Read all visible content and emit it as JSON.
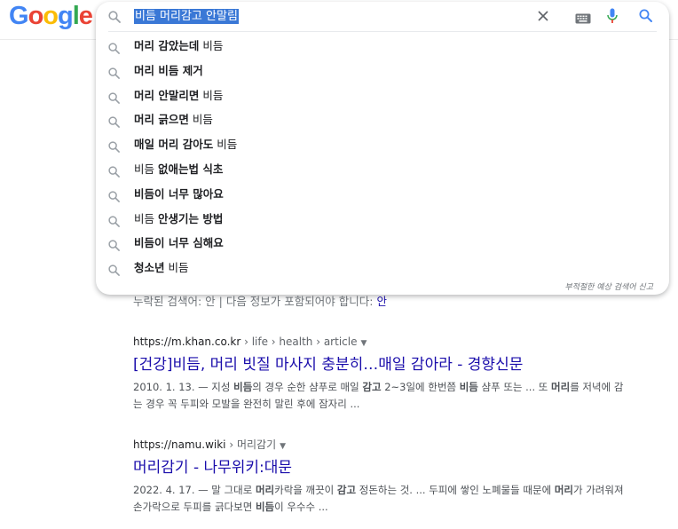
{
  "brand": {
    "logo_letters": [
      "G",
      "o",
      "o",
      "g",
      "l",
      "e"
    ],
    "logo_colors": [
      "#4285f4",
      "#ea4335",
      "#fbbc05",
      "#4285f4",
      "#34a853",
      "#ea4335"
    ]
  },
  "search": {
    "query": "비듬 머리감고 안말림",
    "icons": {
      "lens": "search-icon",
      "clear": "close-icon",
      "keyboard": "keyboard-icon",
      "mic": "mic-icon",
      "submit": "search-icon"
    }
  },
  "suggestions": [
    {
      "bold": "머리 감았는데",
      "rest": " 비듬"
    },
    {
      "bold": "머리 비듬 제거",
      "rest": ""
    },
    {
      "bold": "머리 안말리면",
      "rest": " 비듬"
    },
    {
      "bold": "머리 긁으면",
      "rest": " 비듬"
    },
    {
      "bold": "매일 머리 감아도",
      "rest": " 비듬"
    },
    {
      "bold_pre": "",
      "pre": "비듬 ",
      "bold": "없애는법 식초",
      "rest": ""
    },
    {
      "bold": "비듬이 너무 많아요",
      "rest": ""
    },
    {
      "pre": "비듬 ",
      "bold": "안생기는 방법",
      "rest": ""
    },
    {
      "bold": "비듬이 너무 심해요",
      "rest": ""
    },
    {
      "bold": "청소년",
      "rest": " 비듬"
    }
  ],
  "report_link": "부적절한 예상 검색어 신고",
  "partial_line": {
    "text": "누락된 검색어: 안 | 다음 정보가 포함되어야 합니다:",
    "link": "안"
  },
  "results": [
    {
      "site": "https://m.khan.co.kr",
      "crumbs": " › life › health › article",
      "title": "[건강]비듬, 머리 빗질 마사지 충분히…매일 감아라 - 경향신문",
      "snippet_html": "2010. 1. 13. — 지성 <b>비듬</b>의 경우 순한 샴푸로 매일 <b>감고</b> 2~3일에 한번쯤 <b>비듬</b> 샴푸 또는 ... 또 <b>머리</b>를 저녁에 감는 경우 꼭 두피와 모발을 완전히 말린 후에 잠자리 ..."
    },
    {
      "site": "https://namu.wiki",
      "crumbs": " › 머리감기",
      "title": "머리감기 - 나무위키:대문",
      "snippet_html": "2022. 4. 17. — 말 그대로 <b>머리</b>카락을 깨끗이 <b>감고</b> 정돈하는 것. ... 두피에 쌓인 노폐물들 때문에 <b>머리</b>가 가려워져 손가락으로 두피를 긁다보면 <b>비듬</b>이 우수수 ..."
    }
  ],
  "colors": {
    "link": "#1a0dab",
    "query_highlight": "#3a78d6",
    "mic_blue": "#4285f4",
    "mic_red": "#ea4335"
  }
}
